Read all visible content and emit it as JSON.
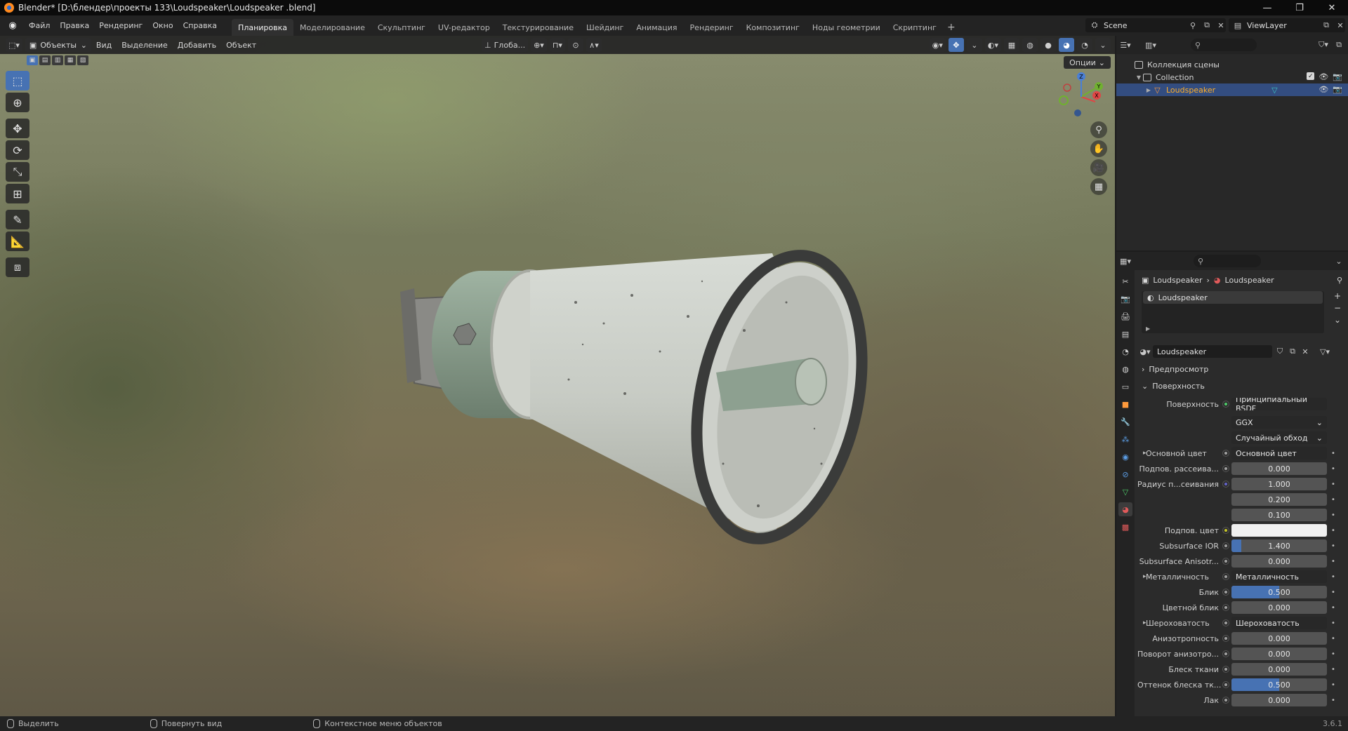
{
  "window": {
    "title": "Blender* [D:\\блендер\\проекты 133\\Loudspeaker\\Loudspeaker .blend]",
    "controls": [
      "—",
      "❐",
      "✕"
    ]
  },
  "menu": [
    "Файл",
    "Правка",
    "Рендеринг",
    "Окно",
    "Справка"
  ],
  "workspaces": [
    {
      "label": "Планировка",
      "active": true
    },
    {
      "label": "Моделирование"
    },
    {
      "label": "Скульптинг"
    },
    {
      "label": "UV-редактор"
    },
    {
      "label": "Текстурирование"
    },
    {
      "label": "Шейдинг"
    },
    {
      "label": "Анимация"
    },
    {
      "label": "Рендеринг"
    },
    {
      "label": "Композитинг"
    },
    {
      "label": "Ноды геометрии"
    },
    {
      "label": "Скриптинг"
    }
  ],
  "workspace_add": "+",
  "scene": {
    "label": "Scene",
    "view_layer": "ViewLayer"
  },
  "viewport": {
    "mode": "Объекты",
    "menus": [
      "Вид",
      "Выделение",
      "Добавить",
      "Объект"
    ],
    "orientation": "Глоба...",
    "options": "Опции",
    "gizmo": {
      "z": "Z",
      "y": "Y",
      "x": "X"
    }
  },
  "outliner": {
    "scene_collection": "Коллекция сцены",
    "collection": "Collection",
    "object": "Loudspeaker"
  },
  "properties": {
    "breadcrumb": [
      "Loudspeaker",
      "Loudspeaker"
    ],
    "slot": "Loudspeaker",
    "material_name": "Loudspeaker",
    "panels": {
      "preview": "Предпросмотр",
      "surface": "Поверхность"
    },
    "surface_label": "Поверхность",
    "surface_value": "Принципиальный BSDF",
    "distribution": "GGX",
    "subsurface_method": "Случайный обход",
    "rows": [
      {
        "label": "Основной цвет",
        "value": "Основной цвет",
        "kind": "link",
        "expand": true
      },
      {
        "label": "Подпов. рассеива...",
        "value": "0.000",
        "kind": "num"
      },
      {
        "label": "Радиус п...сеивания",
        "value": "1.000",
        "kind": "num",
        "dot": "purple"
      },
      {
        "label": "",
        "value": "0.200",
        "kind": "num",
        "nodot": true
      },
      {
        "label": "",
        "value": "0.100",
        "kind": "num",
        "nodot": true
      },
      {
        "label": "Подпов. цвет",
        "value": "",
        "kind": "color",
        "dot": "yellow"
      },
      {
        "label": "Subsurface IOR",
        "value": "1.400",
        "kind": "num",
        "fill": 0.1
      },
      {
        "label": "Subsurface Anisotr...",
        "value": "0.000",
        "kind": "num"
      },
      {
        "label": "Металличность",
        "value": "Металличность",
        "kind": "link",
        "expand": true
      },
      {
        "label": "Блик",
        "value": "0.500",
        "kind": "num",
        "fill": 0.5
      },
      {
        "label": "Цветной блик",
        "value": "0.000",
        "kind": "num"
      },
      {
        "label": "Шероховатость",
        "value": "Шероховатость",
        "kind": "link",
        "expand": true
      },
      {
        "label": "Анизотропность",
        "value": "0.000",
        "kind": "num"
      },
      {
        "label": "Поворот анизотро...",
        "value": "0.000",
        "kind": "num"
      },
      {
        "label": "Блеск ткани",
        "value": "0.000",
        "kind": "num"
      },
      {
        "label": "Оттенок блеска тк...",
        "value": "0.500",
        "kind": "num",
        "fill": 0.5
      },
      {
        "label": "Лак",
        "value": "0.000",
        "kind": "num"
      }
    ]
  },
  "status": {
    "select": "Выделить",
    "rotate": "Повернуть вид",
    "context": "Контекстное меню объектов",
    "version": "3.6.1"
  },
  "colors": {
    "accent": "#4772b3",
    "selected_object": "#ffaf29",
    "background": "#1d1d1d"
  }
}
